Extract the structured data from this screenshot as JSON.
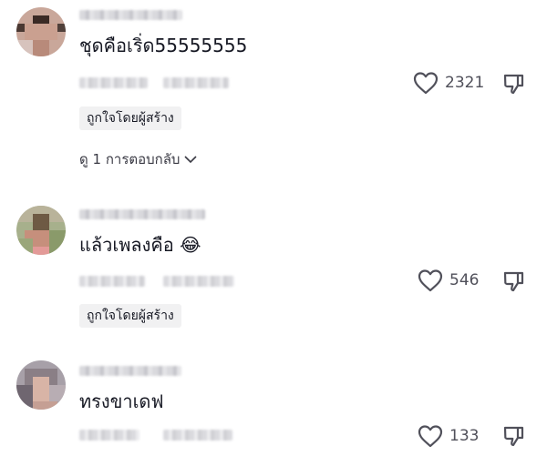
{
  "comments": [
    {
      "text": "ชุดคือเริ่ด55555555",
      "emoji": "",
      "likes": "2321",
      "badge": "ถูกใจโดยผู้สร้าง",
      "replies": "ดู 1 การตอบกลับ"
    },
    {
      "text": "แล้วเพลงคือ",
      "emoji": "😂",
      "likes": "546",
      "badge": "ถูกใจโดยผู้สร้าง",
      "replies": ""
    },
    {
      "text": "ทรงขาเดฟ",
      "emoji": "",
      "likes": "133",
      "badge": "",
      "replies": ""
    }
  ],
  "icons": {
    "like": "heart-outline-icon",
    "dislike": "thumbs-down-icon",
    "expand": "chevron-down-icon"
  },
  "colors": {
    "text": "#161823",
    "muted": "#50505a",
    "badge_bg": "#f1f1f2"
  }
}
